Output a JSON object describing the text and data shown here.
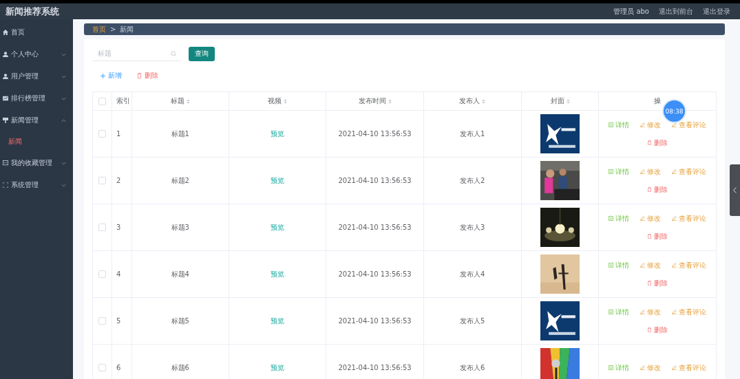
{
  "app_title": "新闻推荐系统",
  "header_links": [
    {
      "label": "管理员 abo",
      "kind": "user"
    },
    {
      "label": "退出到前台",
      "kind": "link"
    },
    {
      "label": "退出登录",
      "kind": "link"
    }
  ],
  "sidebar": {
    "items": [
      {
        "label": "首页"
      },
      {
        "label": "个人中心",
        "expanded": false
      },
      {
        "label": "用户管理",
        "expanded": false
      },
      {
        "label": "排行榜管理",
        "expanded": false
      },
      {
        "label": "新闻管理",
        "expanded": true,
        "children": [
          {
            "label": "新闻",
            "selected": true
          }
        ]
      },
      {
        "label": "我的收藏管理",
        "expanded": false
      },
      {
        "label": "系统管理",
        "expanded": false
      }
    ]
  },
  "breadcrumb": [
    {
      "label": "首页",
      "selected": false
    },
    {
      "label": ">",
      "kind": "separator"
    },
    {
      "label": "新闻",
      "selected": true
    }
  ],
  "search": {
    "placeholder": "标题",
    "button": "查询"
  },
  "toolbar": [
    {
      "label": "新增",
      "kind": "add"
    },
    {
      "label": "删除",
      "kind": "delete"
    }
  ],
  "timer_badge": "08:38",
  "table": {
    "select_all_checked": false,
    "columns": [
      {
        "label": "索引",
        "sortable": false
      },
      {
        "label": "标题",
        "sortable": true
      },
      {
        "label": "视频",
        "sortable": true
      },
      {
        "label": "发布时间",
        "sortable": true
      },
      {
        "label": "发布人",
        "sortable": true
      },
      {
        "label": "封面",
        "sortable": true
      },
      {
        "label": "操",
        "sortable": false
      }
    ],
    "rows": [
      {
        "checked": false,
        "index": "1",
        "title": "标题1",
        "video": "预览",
        "time": "2021-04-10 13:56:53",
        "publisher": "发布人1",
        "cover": {
          "kind": "picture"
        },
        "actions": [
          {
            "label": "详情",
            "kind": "detail"
          },
          {
            "label": "修改",
            "kind": "edit"
          },
          {
            "label": "查看评论",
            "kind": "edit"
          },
          {
            "label": "删除",
            "kind": "delete"
          }
        ]
      },
      {
        "checked": false,
        "index": "2",
        "title": "标题2",
        "video": "预览",
        "time": "2021-04-10 13:56:53",
        "publisher": "发布人2",
        "cover": {
          "kind": "picture"
        },
        "actions": [
          {
            "label": "详情",
            "kind": "detail"
          },
          {
            "label": "修改",
            "kind": "edit"
          },
          {
            "label": "查看评论",
            "kind": "edit"
          },
          {
            "label": "删除",
            "kind": "delete"
          }
        ]
      },
      {
        "checked": false,
        "index": "3",
        "title": "标题3",
        "video": "预览",
        "time": "2021-04-10 13:56:53",
        "publisher": "发布人3",
        "cover": {
          "kind": "picture"
        },
        "actions": [
          {
            "label": "详情",
            "kind": "detail"
          },
          {
            "label": "修改",
            "kind": "edit"
          },
          {
            "label": "查看评论",
            "kind": "edit"
          },
          {
            "label": "删除",
            "kind": "delete"
          }
        ]
      },
      {
        "checked": false,
        "index": "4",
        "title": "标题4",
        "video": "预览",
        "time": "2021-04-10 13:56:53",
        "publisher": "发布人4",
        "cover": {
          "kind": "picture"
        },
        "actions": [
          {
            "label": "详情",
            "kind": "detail"
          },
          {
            "label": "修改",
            "kind": "edit"
          },
          {
            "label": "查看评论",
            "kind": "edit"
          },
          {
            "label": "删除",
            "kind": "delete"
          }
        ]
      },
      {
        "checked": false,
        "index": "5",
        "title": "标题5",
        "video": "预览",
        "time": "2021-04-10 13:56:53",
        "publisher": "发布人5",
        "cover": {
          "kind": "picture"
        },
        "actions": [
          {
            "label": "详情",
            "kind": "detail"
          },
          {
            "label": "修改",
            "kind": "edit"
          },
          {
            "label": "查看评论",
            "kind": "edit"
          },
          {
            "label": "删除",
            "kind": "delete"
          }
        ]
      },
      {
        "checked": false,
        "index": "6",
        "title": "标题6",
        "video": "预览",
        "time": "2021-04-10 13:56:53",
        "publisher": "发布人6",
        "cover": {
          "kind": "picture"
        },
        "actions": [
          {
            "label": "详情",
            "kind": "detail"
          },
          {
            "label": "修改",
            "kind": "edit"
          },
          {
            "label": "查看评论",
            "kind": "edit"
          }
        ]
      }
    ]
  }
}
